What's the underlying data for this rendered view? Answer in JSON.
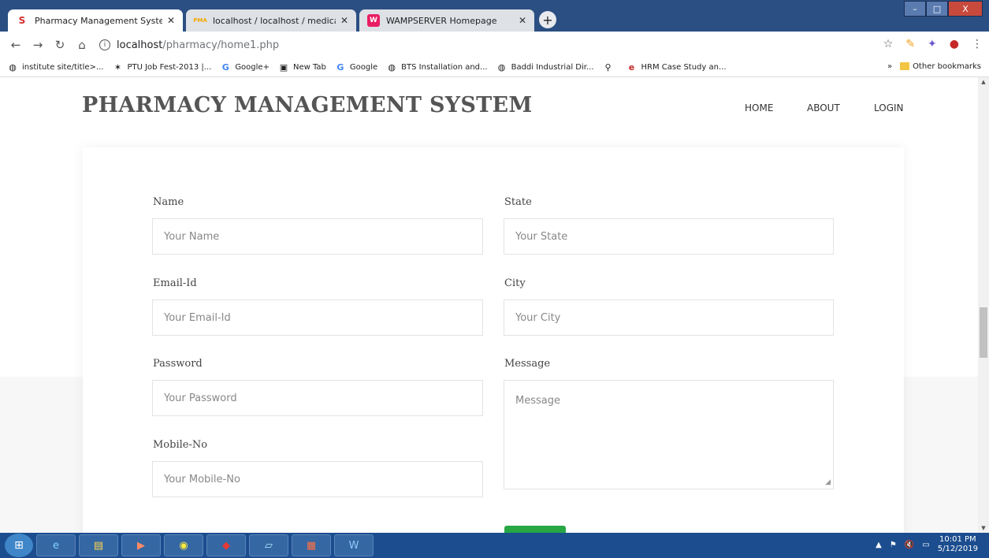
{
  "browser": {
    "tabs": [
      {
        "title": "Pharmacy Management System",
        "icon": "S",
        "icon_color": "#d32f2f",
        "active": true
      },
      {
        "title": "localhost / localhost / medical / t",
        "icon": "PMA",
        "icon_color": "#f2a900",
        "active": false
      },
      {
        "title": "WAMPSERVER Homepage",
        "icon": "W",
        "icon_color": "#e91e63",
        "active": false
      }
    ],
    "new_tab": "+",
    "window_controls": {
      "minimize": "–",
      "maximize": "□",
      "close": "X"
    },
    "address": {
      "host": "localhost",
      "path": "/pharmacy/home1.php"
    },
    "bookmarks": [
      {
        "label": "institute site/title>...",
        "icon": "globe-icon"
      },
      {
        "label": "PTU Job Fest-2013 |...",
        "icon": "star-icon"
      },
      {
        "label": "Google+",
        "icon": "google-icon"
      },
      {
        "label": "New Tab",
        "icon": "newtab-icon"
      },
      {
        "label": "Google",
        "icon": "google-icon"
      },
      {
        "label": "BTS Installation and...",
        "icon": "globe-icon"
      },
      {
        "label": "Baddi Industrial Dir...",
        "icon": "globe-icon"
      },
      {
        "label": "",
        "icon": "search-icon"
      },
      {
        "label": "HRM Case Study an...",
        "icon": "ie-icon"
      }
    ],
    "bookmarks_more": "»",
    "other_bookmarks": "Other bookmarks"
  },
  "site": {
    "brand": "PHARMACY MANAGEMENT SYSTEM",
    "nav": [
      "HOME",
      "ABOUT",
      "LOGIN"
    ]
  },
  "form": {
    "name": {
      "label": "Name",
      "placeholder": "Your Name"
    },
    "email": {
      "label": "Email-Id",
      "placeholder": "Your Email-Id"
    },
    "password": {
      "label": "Password",
      "placeholder": "Your Password"
    },
    "mobile": {
      "label": "Mobile-No",
      "placeholder": "Your Mobile-No"
    },
    "state": {
      "label": "State",
      "placeholder": "Your State"
    },
    "city": {
      "label": "City",
      "placeholder": "Your City"
    },
    "message": {
      "label": "Message",
      "placeholder": "Message"
    },
    "submit_color": "#28a745"
  },
  "taskbar": {
    "time": "10:01 PM",
    "date": "5/12/2019"
  }
}
